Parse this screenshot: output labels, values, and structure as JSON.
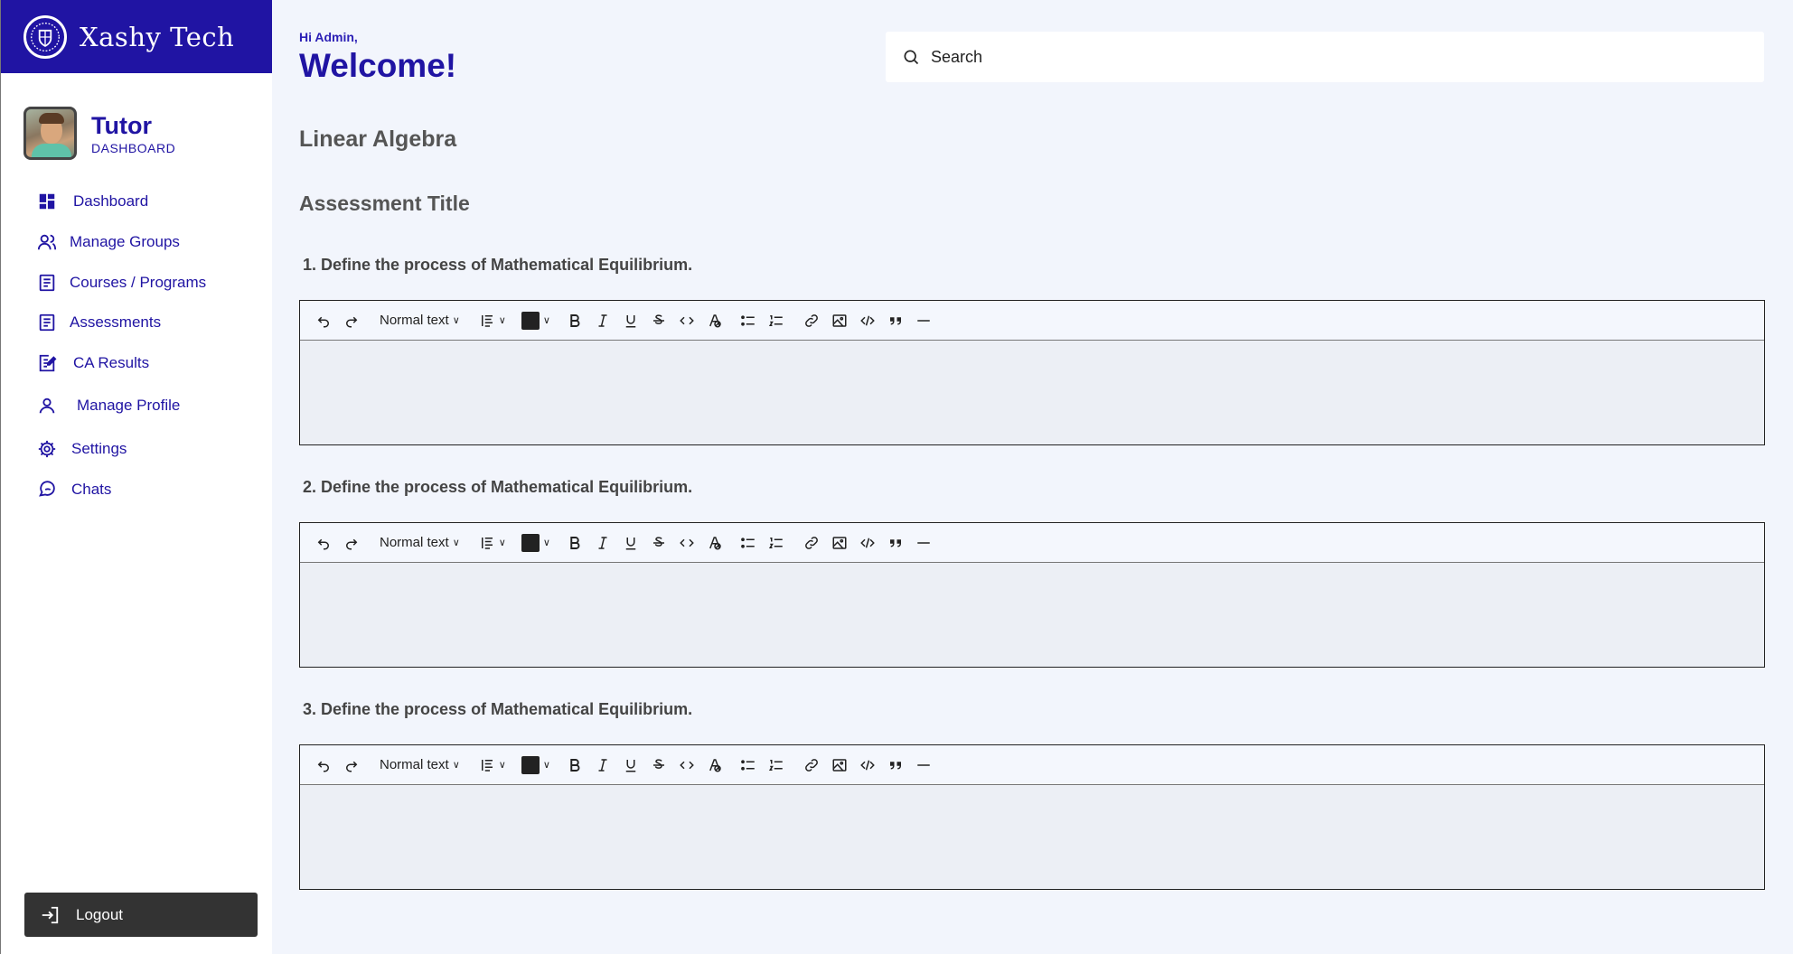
{
  "brand": {
    "name": "Xashy Tech"
  },
  "profile": {
    "role": "Tutor",
    "subtitle": "DASHBOARD"
  },
  "sidebar": {
    "items": [
      {
        "label": "Dashboard",
        "icon": "grid-icon"
      },
      {
        "label": "Manage Groups",
        "icon": "users-icon"
      },
      {
        "label": "Courses / Programs",
        "icon": "document-icon"
      },
      {
        "label": "Assessments",
        "icon": "document-icon"
      },
      {
        "label": "CA Results",
        "icon": "edit-document-icon"
      },
      {
        "label": "Manage Profile",
        "icon": "user-icon"
      },
      {
        "label": "Settings",
        "icon": "gear-icon"
      },
      {
        "label": "Chats",
        "icon": "chat-icon"
      }
    ],
    "logout": "Logout"
  },
  "header": {
    "greeting": "Hi Admin,",
    "welcome": "Welcome!",
    "search_placeholder": "Search"
  },
  "main": {
    "course": "Linear Algebra",
    "assessment_title": "Assessment Title",
    "questions": [
      {
        "label": "1. Define the process of Mathematical Equilibrium."
      },
      {
        "label": "2. Define the process of Mathematical Equilibrium."
      },
      {
        "label": "3. Define the process of Mathematical Equilibrium."
      }
    ],
    "toolbar": {
      "text_style": "Normal text"
    }
  },
  "colors": {
    "brand": "#2014a3",
    "background": "#f2f5fc",
    "logout_bg": "#333333"
  }
}
